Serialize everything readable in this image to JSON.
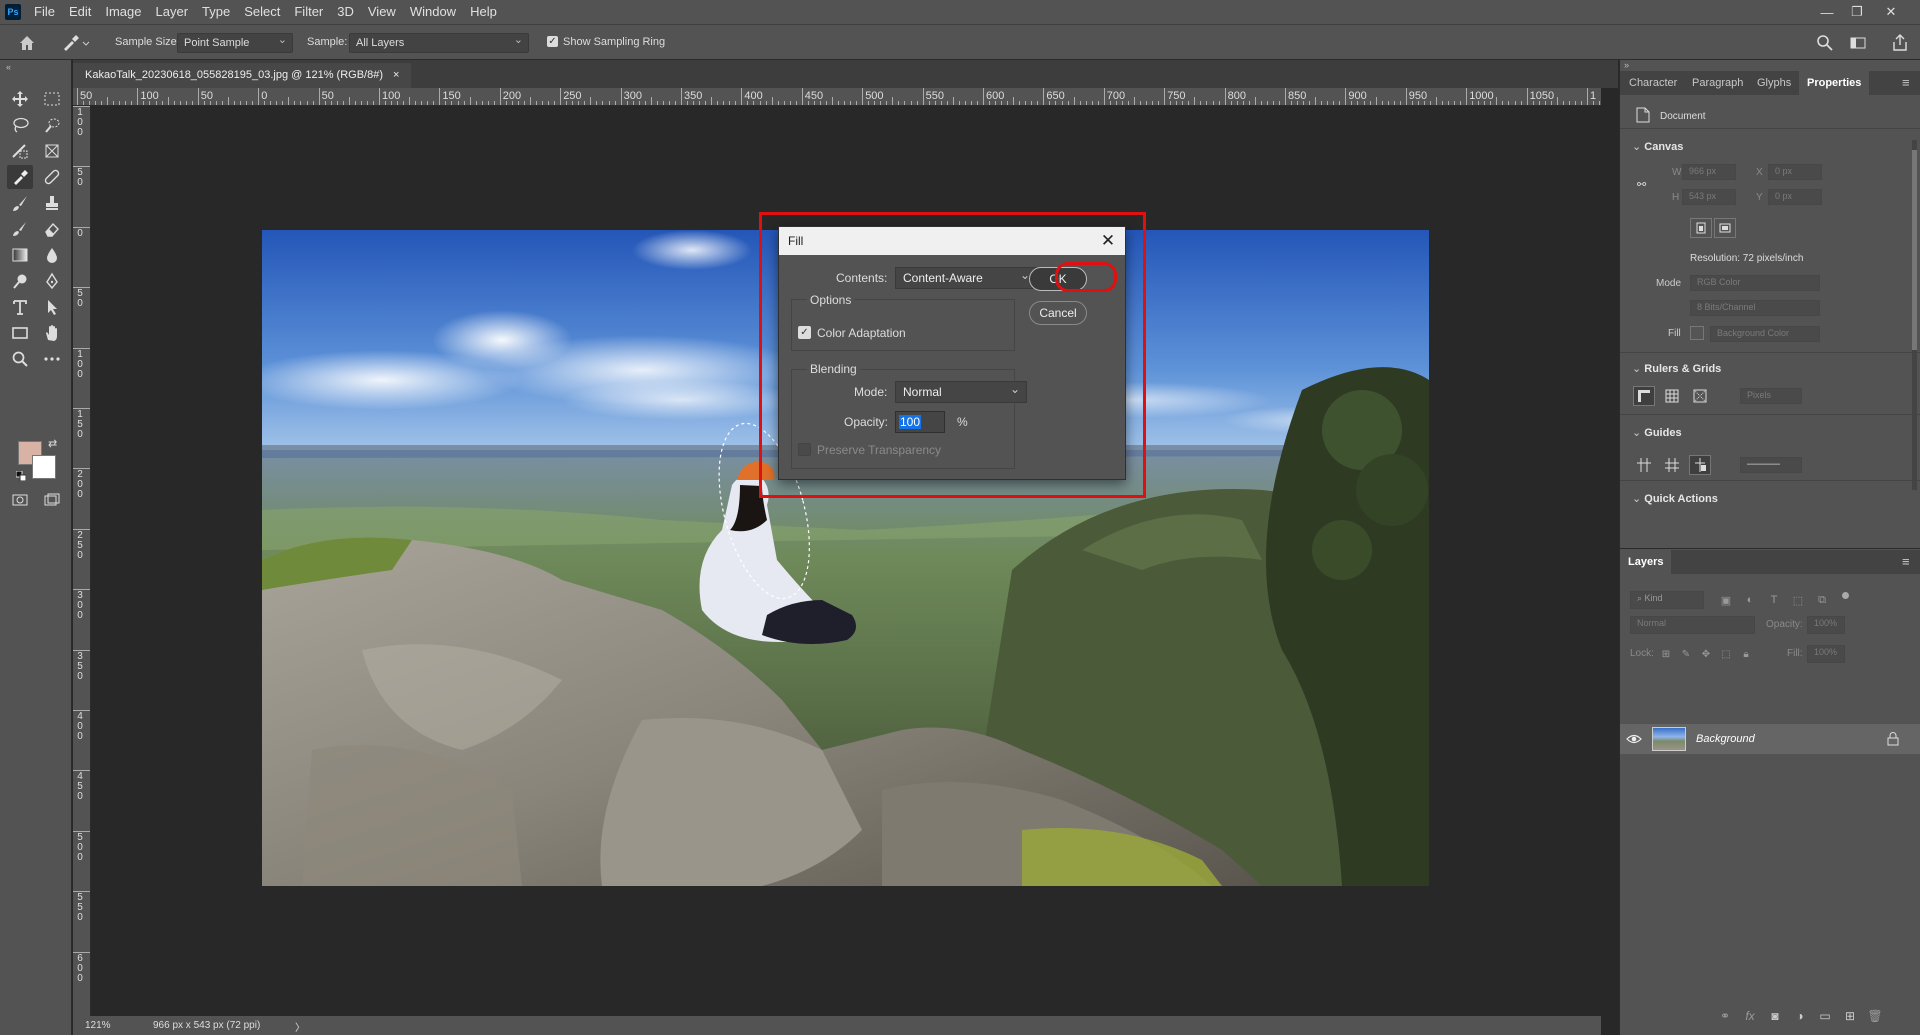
{
  "app": {
    "logo": "Ps"
  },
  "menu": [
    "File",
    "Edit",
    "Image",
    "Layer",
    "Type",
    "Select",
    "Filter",
    "3D",
    "View",
    "Window",
    "Help"
  ],
  "window_controls": {
    "minimize": "—",
    "restore": "❐",
    "close": "✕"
  },
  "options_bar": {
    "sample_size_label": "Sample Size:",
    "sample_size_value": "Point Sample",
    "sample_label": "Sample:",
    "sample_value": "All Layers",
    "show_sampling_ring_label": "Show Sampling Ring",
    "show_sampling_ring_checked": true
  },
  "document": {
    "tab_title": "KakaoTalk_20230618_055828195_03.jpg @ 121% (RGB/8#)",
    "tab_close": "×"
  },
  "ruler": {
    "h_labels": [
      "50",
      "100",
      "50",
      "0",
      "50",
      "100",
      "150",
      "200",
      "250",
      "300",
      "350",
      "400",
      "450",
      "500",
      "550",
      "600",
      "650",
      "700",
      "750",
      "800",
      "850",
      "900",
      "950",
      "1000",
      "1050",
      "1"
    ],
    "v_labels": [
      [
        "1",
        "0",
        "0"
      ],
      [
        "5",
        "0"
      ],
      [
        "0"
      ],
      [
        "5",
        "0"
      ],
      [
        "1",
        "0",
        "0"
      ],
      [
        "1",
        "5",
        "0"
      ],
      [
        "2",
        "0",
        "0"
      ],
      [
        "2",
        "5",
        "0"
      ],
      [
        "3",
        "0",
        "0"
      ],
      [
        "3",
        "5",
        "0"
      ],
      [
        "4",
        "0",
        "0"
      ],
      [
        "4",
        "5",
        "0"
      ],
      [
        "5",
        "0",
        "0"
      ],
      [
        "5",
        "5",
        "0"
      ],
      [
        "6",
        "0",
        "0"
      ]
    ]
  },
  "status_bar": {
    "zoom": "121%",
    "doc_info": "966 px x 543 px (72 ppi)",
    "arrow": "〉"
  },
  "fill_dialog": {
    "title": "Fill",
    "contents_label": "Contents:",
    "contents_value": "Content-Aware",
    "ok_label": "OK",
    "cancel_label": "Cancel",
    "options_group": "Options",
    "color_adaptation_label": "Color Adaptation",
    "color_adaptation_checked": true,
    "blending_group": "Blending",
    "mode_label": "Mode:",
    "mode_value": "Normal",
    "opacity_label": "Opacity:",
    "opacity_value": "100",
    "opacity_unit": "%",
    "preserve_transparency_label": "Preserve Transparency",
    "preserve_transparency_enabled": false
  },
  "properties_panel": {
    "tabs": [
      "Character",
      "Paragraph",
      "Glyphs",
      "Properties"
    ],
    "active_tab": "Properties",
    "document_label": "Document",
    "canvas_section": "Canvas",
    "w_label": "W",
    "w_value": "966 px",
    "h_label": "H",
    "h_value": "543 px",
    "x_label": "X",
    "x_value": "0 px",
    "y_label": "Y",
    "y_value": "0 px",
    "resolution": "Resolution: 72 pixels/inch",
    "mode_label": "Mode",
    "mode_value": "RGB Color",
    "bits_value": "8 Bits/Channel",
    "fill_label": "Fill",
    "fill_value": "Background Color",
    "rulers_section": "Rulers & Grids",
    "units_value": "Pixels",
    "guides_section": "Guides",
    "quick_actions_section": "Quick Actions"
  },
  "layers_panel": {
    "title": "Layers",
    "kind_placeholder": "Kind",
    "blend_mode": "Normal",
    "opacity_label": "Opacity:",
    "opacity_value": "100%",
    "lock_label": "Lock:",
    "fill_label": "Fill:",
    "fill_value": "100%",
    "layer_name": "Background",
    "bottom_icons": [
      "link-icon",
      "fx-icon",
      "mask-icon",
      "adjustment-icon",
      "folder-icon",
      "new-layer-icon",
      "trash-icon"
    ],
    "fx_glyph": "fx"
  },
  "colors": {
    "foreground": "#d8b3a5",
    "background": "#ffffff",
    "highlight": "#e01010",
    "accent": "#1473e6"
  }
}
